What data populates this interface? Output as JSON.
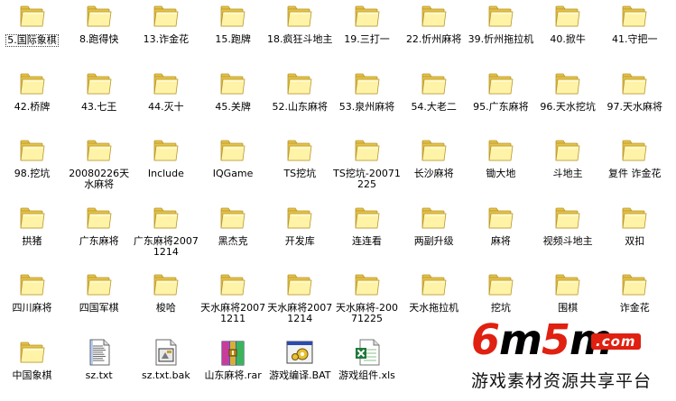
{
  "items": [
    {
      "label": "5.国际象棋",
      "icon": "folder-icon",
      "selected": true
    },
    {
      "label": "8.跑得快",
      "icon": "folder-icon"
    },
    {
      "label": "13.诈金花",
      "icon": "folder-icon"
    },
    {
      "label": "15.跑牌",
      "icon": "folder-icon"
    },
    {
      "label": "18.疯狂斗地主",
      "icon": "folder-icon"
    },
    {
      "label": "19.三打一",
      "icon": "folder-icon"
    },
    {
      "label": "22.忻州麻将",
      "icon": "folder-icon"
    },
    {
      "label": "39.忻州拖拉机",
      "icon": "folder-icon"
    },
    {
      "label": "40.掀牛",
      "icon": "folder-icon"
    },
    {
      "label": "41.守把一",
      "icon": "folder-icon"
    },
    {
      "label": "42.桥牌",
      "icon": "folder-icon"
    },
    {
      "label": "43.七王",
      "icon": "folder-icon"
    },
    {
      "label": "44.灭十",
      "icon": "folder-icon"
    },
    {
      "label": "45.关牌",
      "icon": "folder-icon"
    },
    {
      "label": "52.山东麻将",
      "icon": "folder-icon"
    },
    {
      "label": "53.泉州麻将",
      "icon": "folder-icon"
    },
    {
      "label": "54.大老二",
      "icon": "folder-icon"
    },
    {
      "label": "95.广东麻将",
      "icon": "folder-icon"
    },
    {
      "label": "96.天水挖坑",
      "icon": "folder-icon"
    },
    {
      "label": "97.天水麻将",
      "icon": "folder-icon"
    },
    {
      "label": "98.挖坑",
      "icon": "folder-icon"
    },
    {
      "label": "20080226天水麻将",
      "icon": "folder-icon"
    },
    {
      "label": "Include",
      "icon": "folder-icon"
    },
    {
      "label": "IQGame",
      "icon": "folder-icon"
    },
    {
      "label": "TS挖坑",
      "icon": "folder-icon"
    },
    {
      "label": "TS挖坑-20071225",
      "icon": "folder-icon"
    },
    {
      "label": "长沙麻将",
      "icon": "folder-icon"
    },
    {
      "label": "锄大地",
      "icon": "folder-icon"
    },
    {
      "label": "斗地主",
      "icon": "folder-icon"
    },
    {
      "label": "复件 诈金花",
      "icon": "folder-icon"
    },
    {
      "label": "拱猪",
      "icon": "folder-icon"
    },
    {
      "label": "广东麻将",
      "icon": "folder-icon"
    },
    {
      "label": "广东麻将20071214",
      "icon": "folder-icon"
    },
    {
      "label": "黑杰克",
      "icon": "folder-icon"
    },
    {
      "label": "开发库",
      "icon": "folder-icon"
    },
    {
      "label": "连连看",
      "icon": "folder-icon"
    },
    {
      "label": "两副升级",
      "icon": "folder-icon"
    },
    {
      "label": "麻将",
      "icon": "folder-icon"
    },
    {
      "label": "视频斗地主",
      "icon": "folder-icon"
    },
    {
      "label": "双扣",
      "icon": "folder-icon"
    },
    {
      "label": "四川麻将",
      "icon": "folder-icon"
    },
    {
      "label": "四国军棋",
      "icon": "folder-icon"
    },
    {
      "label": "梭哈",
      "icon": "folder-icon"
    },
    {
      "label": "天水麻将20071211",
      "icon": "folder-icon"
    },
    {
      "label": "天水麻将20071214",
      "icon": "folder-icon"
    },
    {
      "label": "天水麻将-20071225",
      "icon": "folder-icon"
    },
    {
      "label": "天水拖拉机",
      "icon": "folder-icon"
    },
    {
      "label": "挖坑",
      "icon": "folder-icon"
    },
    {
      "label": "围棋",
      "icon": "folder-icon"
    },
    {
      "label": "诈金花",
      "icon": "folder-icon"
    },
    {
      "label": "中国象棋",
      "icon": "folder-icon"
    },
    {
      "label": "sz.txt",
      "icon": "text-file-icon"
    },
    {
      "label": "sz.txt.bak",
      "icon": "bak-file-icon"
    },
    {
      "label": "山东麻将.rar",
      "icon": "rar-archive-icon"
    },
    {
      "label": "游戏编译.BAT",
      "icon": "batch-file-icon"
    },
    {
      "label": "游戏组件.xls",
      "icon": "excel-file-icon"
    }
  ],
  "watermark": {
    "word_num1": "6",
    "word_m1": "m",
    "word_num2": "5",
    "word_m2": "m",
    "dotcom": ".com",
    "tagline": "游戏素材资源共享平台"
  },
  "colors": {
    "folder_light": "#fff3a8",
    "folder_dark": "#e5c24a",
    "folder_edge": "#b8962a",
    "brand_red": "#e02010"
  }
}
